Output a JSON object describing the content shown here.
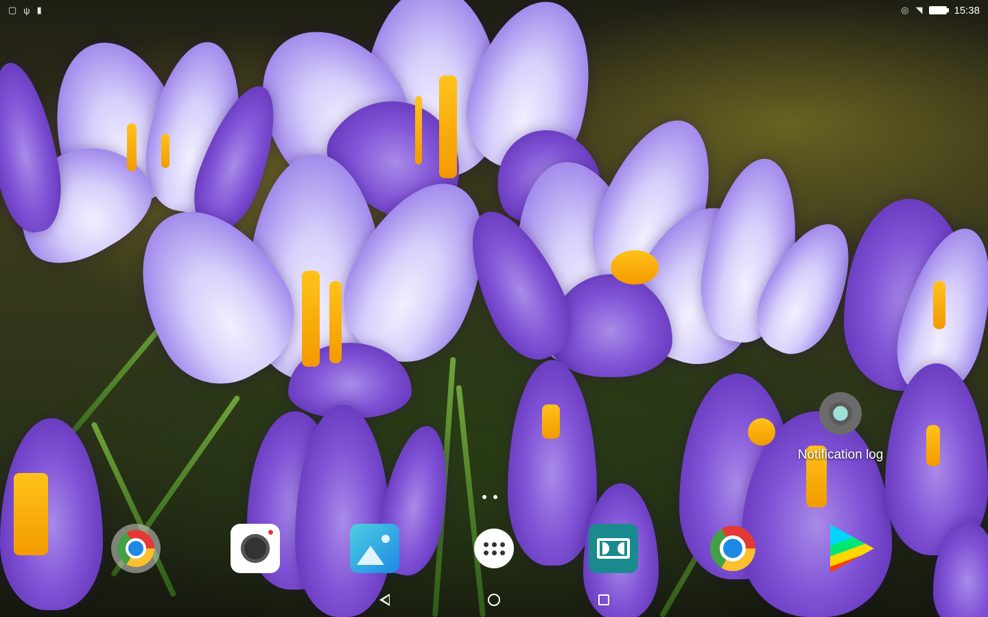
{
  "status_bar": {
    "time": "15:38",
    "left_icons": [
      "notification-icon",
      "usb-icon",
      "sd-card-icon"
    ],
    "right_icons": [
      "data-saver-icon",
      "wifi-icon",
      "battery-icon"
    ]
  },
  "widget": {
    "label": "Notification log",
    "icon": "gear-icon"
  },
  "home_pages": {
    "count": 2
  },
  "dock": {
    "apps": [
      {
        "name": "folder",
        "icon": "chrome-folder-icon"
      },
      {
        "name": "camera",
        "icon": "camera-icon"
      },
      {
        "name": "gallery",
        "icon": "gallery-icon"
      },
      {
        "name": "all-apps",
        "icon": "app-drawer-icon"
      },
      {
        "name": "dolby",
        "icon": "dolby-icon"
      },
      {
        "name": "chrome",
        "icon": "chrome-icon"
      },
      {
        "name": "play-store",
        "icon": "play-store-icon"
      }
    ]
  },
  "nav_bar": {
    "buttons": [
      "back",
      "home",
      "recents"
    ]
  },
  "colors": {
    "accent_teal": "#1a8a8f",
    "flower_purple": "#7f52d6",
    "stamen_orange": "#f39a00"
  }
}
